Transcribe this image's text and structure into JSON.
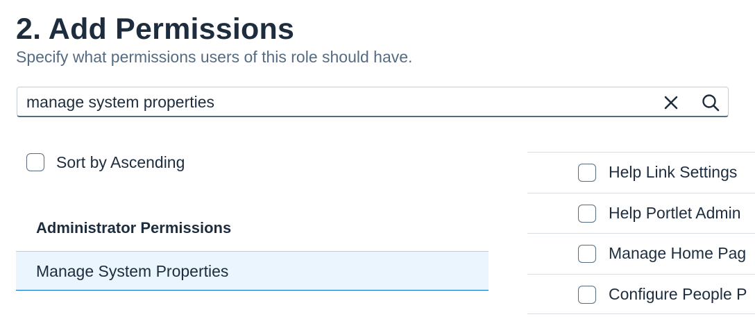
{
  "header": {
    "title": "2. Add Permissions",
    "subtitle": "Specify what permissions users of this role should have."
  },
  "search": {
    "value": "manage system properties",
    "clear_icon": "close-icon",
    "search_icon": "search-icon"
  },
  "sort": {
    "label": "Sort by Ascending",
    "checked": false
  },
  "categories": {
    "header": "Administrator Permissions",
    "selected_item": "Manage System Properties"
  },
  "permissions": [
    {
      "label": "Help Link Settings",
      "checked": false
    },
    {
      "label": "Help Portlet Admin",
      "checked": false
    },
    {
      "label": "Manage Home Pag",
      "checked": false
    },
    {
      "label": "Configure People P",
      "checked": false
    }
  ]
}
